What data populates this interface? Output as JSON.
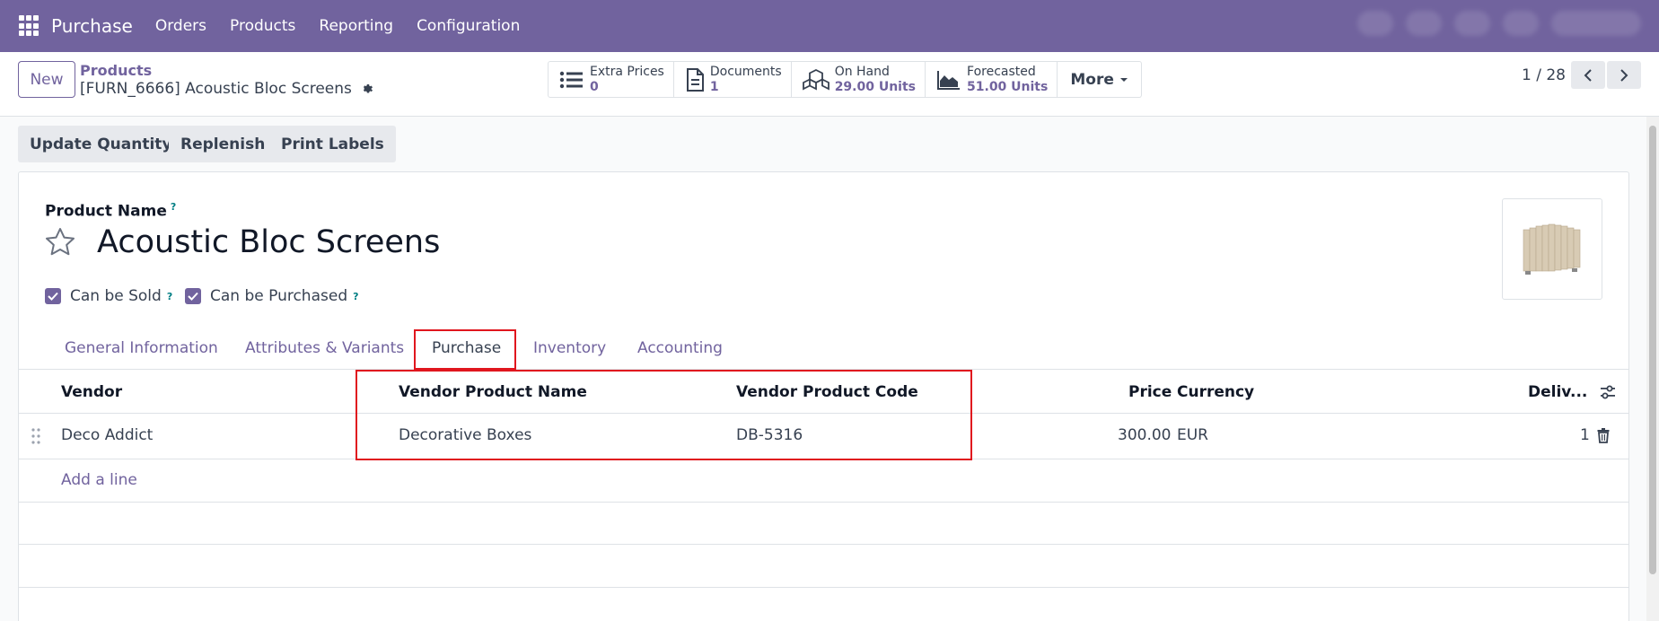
{
  "nav": {
    "app_name": "Purchase",
    "menu": [
      "Orders",
      "Products",
      "Reporting",
      "Configuration"
    ]
  },
  "control": {
    "new_label": "New",
    "breadcrumb_parent": "Products",
    "breadcrumb_current": "[FURN_6666] Acoustic Bloc Screens",
    "smart_buttons": [
      {
        "label": "Extra Prices",
        "value": "0",
        "icon": "list-icon"
      },
      {
        "label": "Documents",
        "value": "1",
        "icon": "document-icon"
      },
      {
        "label": "On Hand",
        "value": "29.00 Units",
        "icon": "cubes-icon"
      },
      {
        "label": "Forecasted",
        "value": "51.00 Units",
        "icon": "area-chart-icon"
      }
    ],
    "more_label": "More",
    "pager": "1 / 28"
  },
  "actions": [
    "Update Quantity",
    "Replenish",
    "Print Labels"
  ],
  "form": {
    "product_name_label": "Product Name",
    "tooltip_mark": "?",
    "product_name": "Acoustic Bloc Screens",
    "can_be_sold": "Can be Sold",
    "can_be_purchased": "Can be Purchased"
  },
  "tabs": [
    "General Information",
    "Attributes & Variants",
    "Purchase",
    "Inventory",
    "Accounting"
  ],
  "table": {
    "headers": {
      "vendor": "Vendor",
      "vendor_product_name": "Vendor Product Name",
      "vendor_product_code": "Vendor Product Code",
      "price": "Price",
      "currency": "Currency",
      "delivery": "Deliv..."
    },
    "rows": [
      {
        "vendor": "Deco Addict",
        "vendor_product_name": "Decorative Boxes",
        "vendor_product_code": "DB-5316",
        "price": "300.00",
        "currency": "EUR",
        "delivery": "1"
      }
    ],
    "add_line": "Add a line"
  },
  "colors": {
    "brand": "#71639e",
    "highlight": "#e0161e",
    "tooltip": "#017e84"
  }
}
